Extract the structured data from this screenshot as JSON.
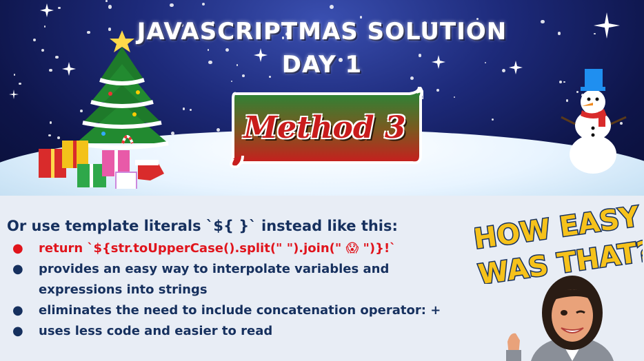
{
  "title": {
    "line1": "JAVASCRIPTMAS SOLUTION",
    "line2": "DAY 1"
  },
  "scroll_label": "Method 3",
  "content": {
    "heading": "Or use template literals `${ }` instead like this:",
    "bullets": [
      {
        "text": "return `${str.toUpperCase().split(\" \").join(\" 😱 \")}!`",
        "color": "#e0141c"
      },
      {
        "text": "provides an easy way to interpolate variables and",
        "color": "#16305e"
      },
      {
        "text": "expressions into strings",
        "color": "#16305e",
        "continuation": true
      },
      {
        "text": "eliminates the need to include concatenation operator: +",
        "color": "#16305e"
      },
      {
        "text": "uses less code and easier to read",
        "color": "#16305e"
      }
    ]
  },
  "badge": {
    "line1": "HOW EASY",
    "line2": "WAS THAT?"
  },
  "colors": {
    "sky": "#1d2a7a",
    "scroll_top": "#1f8a3a",
    "scroll_bottom": "#c81e1e",
    "text": "#16305e",
    "accent": "#e0141c",
    "badge_fill": "#f6c21b"
  },
  "icons": [
    "christmas-tree-icon",
    "gift-boxes-icon",
    "snowman-icon",
    "star-icon",
    "bitmoji-character-icon"
  ]
}
